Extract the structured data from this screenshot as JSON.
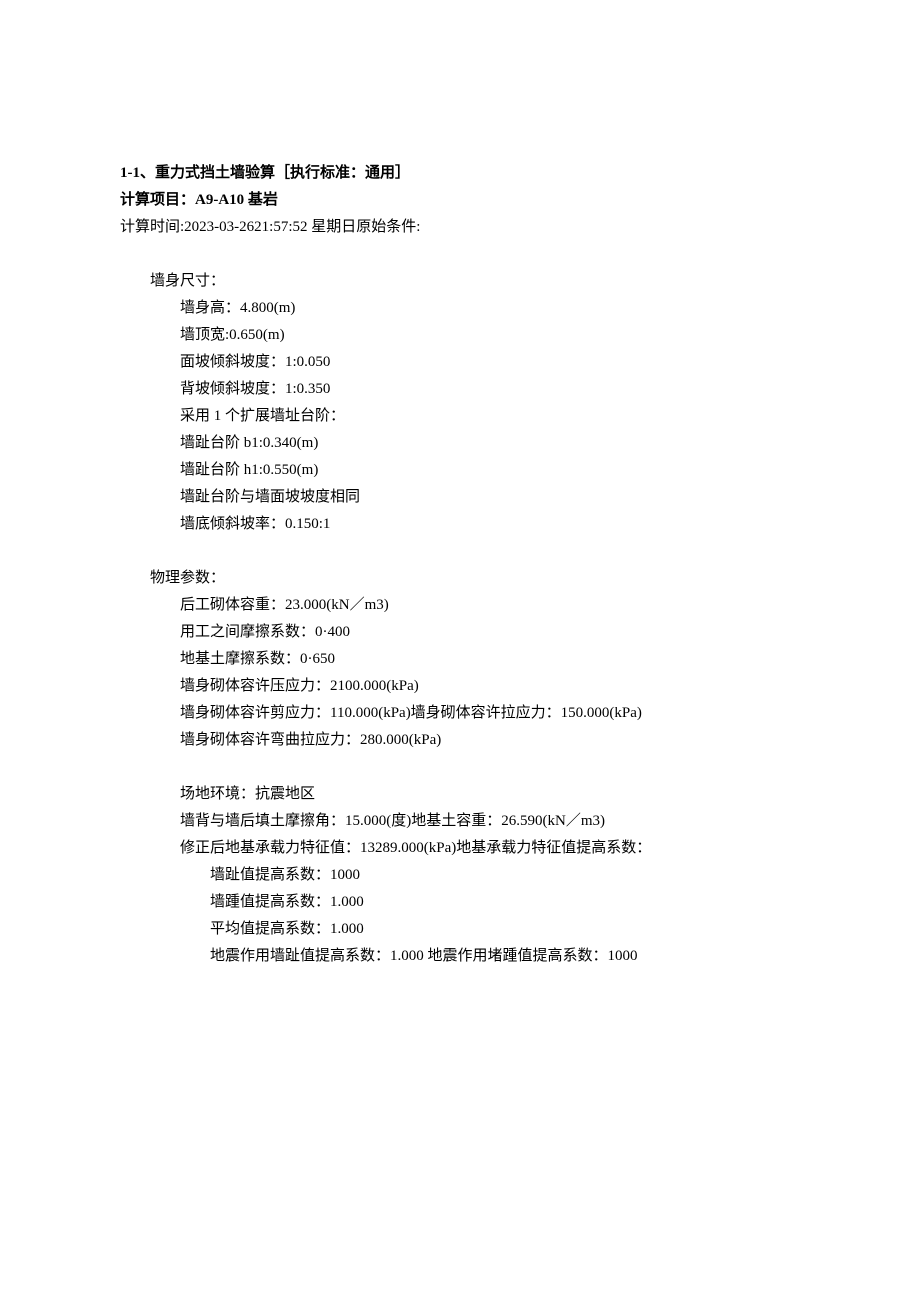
{
  "header": {
    "title_line1": "1-1、重力式挡土墙验算［执行标准：通用］",
    "title_line2": "计算项目：A9-A10 基岩",
    "calc_time": "计算时间:2023-03-2621:57:52 星期日原始条件:"
  },
  "wall_size": {
    "heading": "墙身尺寸：",
    "height": "墙身高：4.800(m)",
    "top_width": "墙顶宽:0.650(m)",
    "face_slope": "面坡倾斜坡度：1:0.050",
    "back_slope": "背坡倾斜坡度：1:0.350",
    "step_use": "采用 1 个扩展墙址台阶：",
    "step_b1": "墙趾台阶 b1:0.340(m)",
    "step_h1": "墙趾台阶 h1:0.550(m)",
    "step_slope": "墙趾台阶与墙面坡坡度相同",
    "bottom_slope": "墙底倾斜坡率：0.150:1"
  },
  "phys": {
    "heading": "物理参数：",
    "unit_weight": "后工砌体容重：23.000(kN／m3)",
    "friction_coef": "用工之间摩擦系数：0·400",
    "soil_friction": "地基土摩擦系数：0·650",
    "compress": "墙身砌体容许压应力：2100.000(kPa)",
    "shear_tension": "墙身砌体容许剪应力：110.000(kPa)墙身砌体容许拉应力：150.000(kPa)",
    "bending": "墙身砌体容许弯曲拉应力：280.000(kPa)"
  },
  "site": {
    "env": "场地环境：抗震地区",
    "friction_angle": "墙背与墙后填土摩擦角：15.000(度)地基土容重：26.590(kN／m3)",
    "bearing": "修正后地基承载力特征值：13289.000(kPa)地基承载力特征值提高系数：",
    "toe_factor": "墙趾值提高系数：1000",
    "heel_factor": "墙踵值提高系数：1.000",
    "avg_factor": "平均值提高系数：1.000",
    "seismic_factor": "地震作用墙趾值提高系数：1.000 地震作用堵踵值提高系数：1000"
  }
}
